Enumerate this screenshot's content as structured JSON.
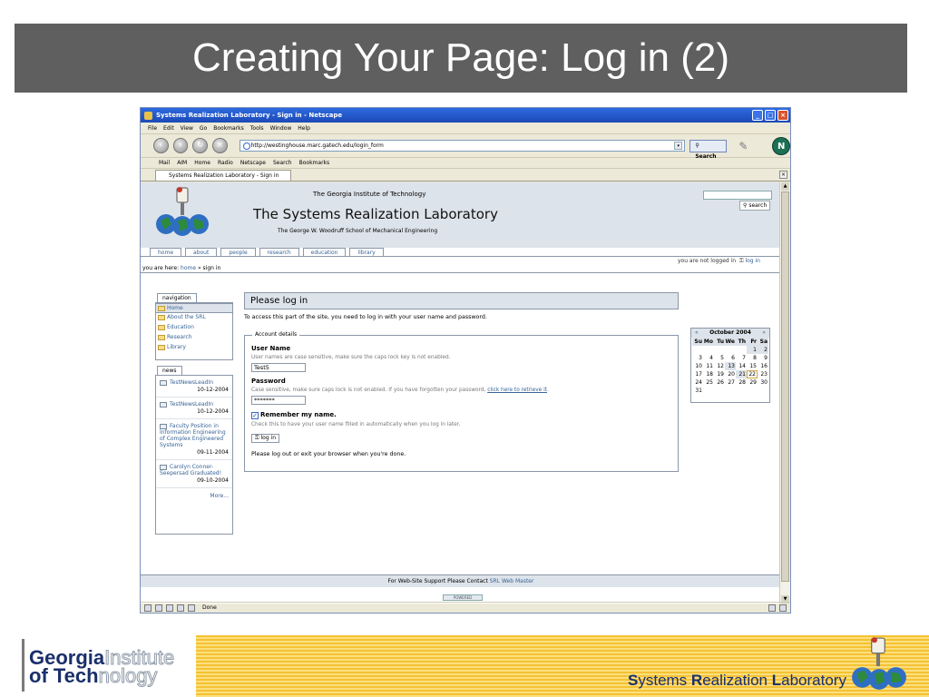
{
  "slide": {
    "title": "Creating Your Page: Log in (2)",
    "footer_logo_line1_bold": "Georgia",
    "footer_logo_line1_light": "Institute",
    "footer_logo_line2_bold": "of Tech",
    "footer_logo_line2_light": "nology",
    "footer_lab_s": "S",
    "footer_lab_ystems": "ystems ",
    "footer_lab_r": "R",
    "footer_lab_ealization": "ealization ",
    "footer_lab_l": "L",
    "footer_lab_aboratory": "aboratory"
  },
  "browser": {
    "window_title": "Systems Realization Laboratory - Sign in - Netscape",
    "menu": [
      "File",
      "Edit",
      "View",
      "Go",
      "Bookmarks",
      "Tools",
      "Window",
      "Help"
    ],
    "url": "http://westinghouse.marc.gatech.edu/login_form",
    "search_label": "Search",
    "personal_toolbar": [
      "Mail",
      "AIM",
      "Home",
      "Radio",
      "Netscape",
      "Search",
      "Bookmarks"
    ],
    "tab_label": "Systems Realization Laboratory - Sign in",
    "status": "Done"
  },
  "site": {
    "institute": "The Georgia Institute of Technology",
    "lab_name": "The Systems Realization Laboratory",
    "school": "The George W. Woodruff School of Mechanical Engineering",
    "search_button": "search",
    "tabs": [
      "home",
      "about",
      "people",
      "research",
      "education",
      "library"
    ],
    "login_status_text": "you are not logged in",
    "login_link": "log in",
    "breadcrumb_prefix": "you are here:",
    "breadcrumb_home": "home",
    "breadcrumb_sep": "»",
    "breadcrumb_current": "sign in",
    "nav_title": "navigation",
    "nav_items": [
      "Home",
      "About the SRL",
      "Education",
      "Research",
      "Library"
    ],
    "news_title": "news",
    "news": [
      {
        "title": "TestNewsLeadIn",
        "date": "10-12-2004"
      },
      {
        "title": "TestNewsLeadIn",
        "date": "10-12-2004"
      },
      {
        "title": "Faculty Position in Information Engineering of Complex Engineered Systems",
        "date": "09-11-2004"
      },
      {
        "title": "Carolyn Conner-Seepersad Graduated!",
        "date": "09-10-2004"
      }
    ],
    "news_more": "More...",
    "footer_text": "For Web-Site Support Please Contact",
    "footer_link": "SRL Web Master",
    "powered_label": "POWERED"
  },
  "login": {
    "heading": "Please log in",
    "intro": "To access this part of the site, you need to log in with your user name and password.",
    "legend": "Account details",
    "username_label": "User Name",
    "username_help": "User names are case sensitive, make sure the caps lock key is not enabled.",
    "username_value": "Test5",
    "password_label": "Password",
    "password_help": "Case sensitive, make sure caps lock is not enabled. If you have forgotten your password,",
    "password_help_link": "click here to retrieve it",
    "password_value": "*******",
    "remember_label": "Remember my name.",
    "remember_help": "Check this to have your user name filled in automatically when you log in later.",
    "login_button": "log in",
    "after_text": "Please log out or exit your browser when you're done."
  },
  "calendar": {
    "month": "October 2004",
    "prev": "«",
    "next": "»",
    "weekdays": [
      "Su",
      "Mo",
      "Tu",
      "We",
      "Th",
      "Fr",
      "Sa"
    ],
    "days": [
      "",
      "",
      "",
      "",
      "",
      "1",
      "2",
      "3",
      "4",
      "5",
      "6",
      "7",
      "8",
      "9",
      "10",
      "11",
      "12",
      "13",
      "14",
      "15",
      "16",
      "17",
      "18",
      "19",
      "20",
      "21",
      "22",
      "23",
      "24",
      "25",
      "26",
      "27",
      "28",
      "29",
      "30",
      "31"
    ],
    "highlighted": [
      "1",
      "2",
      "13",
      "21"
    ],
    "today": "22"
  }
}
